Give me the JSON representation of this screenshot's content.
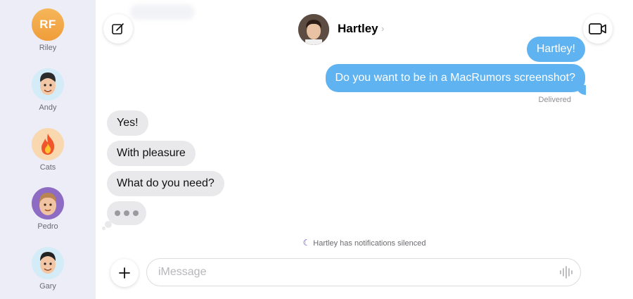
{
  "sidebar": {
    "contacts": [
      {
        "name": "Riley",
        "initials": "RF"
      },
      {
        "name": "Andy"
      },
      {
        "name": "Cats"
      },
      {
        "name": "Pedro"
      },
      {
        "name": "Gary"
      }
    ]
  },
  "header": {
    "contact_name": "Hartley",
    "chevron": "›",
    "compose_icon": "compose-icon",
    "video_icon": "video-camera-icon"
  },
  "messages": {
    "sent": [
      {
        "text": "Hartley!"
      },
      {
        "text": "Do you want to be in a MacRumors screenshot?"
      }
    ],
    "delivered_status": "Delivered",
    "received": [
      {
        "text": "Yes!"
      },
      {
        "text": "With pleasure"
      },
      {
        "text": "What do you need?"
      }
    ],
    "typing_indicator": "typing-indicator"
  },
  "notice": {
    "text": "Hartley has notifications silenced",
    "icon": "moon-icon"
  },
  "composer": {
    "placeholder": "iMessage",
    "value": "",
    "add_icon": "plus-icon",
    "audio_icon": "waveform-icon"
  },
  "colors": {
    "sent_bubble": "#5fb3f0",
    "received_bubble": "#e9e9eb",
    "sidebar_bg": "#ecedf7",
    "moon": "#5b4fc9"
  }
}
